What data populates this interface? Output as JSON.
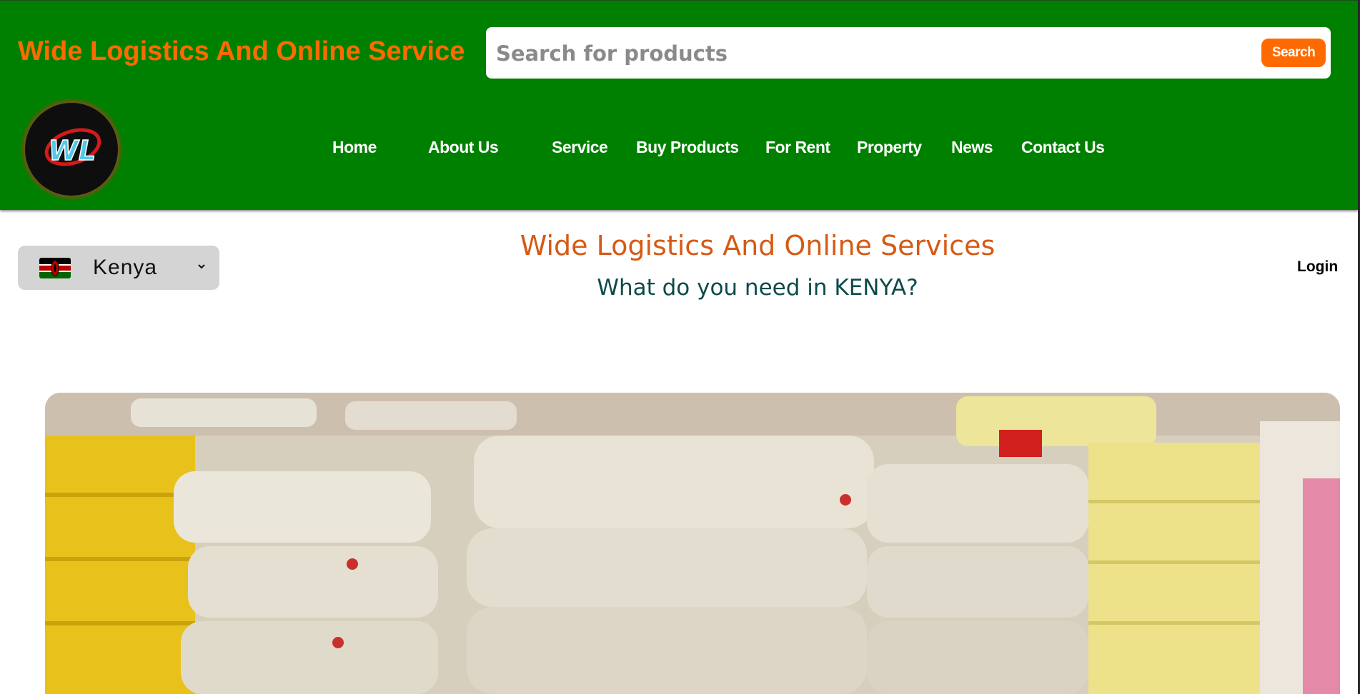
{
  "header": {
    "brand": "Wide Logistics And Online Service",
    "search": {
      "placeholder": "Search for products",
      "value": "",
      "button_label": "Search"
    },
    "logo_text": "WL",
    "nav": [
      {
        "label": "Home"
      },
      {
        "label": "About Us"
      },
      {
        "label": "Service"
      },
      {
        "label": "Buy Products"
      },
      {
        "label": "For Rent"
      },
      {
        "label": "Property"
      },
      {
        "label": "News"
      },
      {
        "label": "Contact Us"
      }
    ]
  },
  "country_selector": {
    "selected": "Kenya",
    "flag_icon": "kenya-flag-icon"
  },
  "main": {
    "title": "Wide Logistics And Online Services",
    "subtitle": "What do you need in KENYA?",
    "login_label": "Login",
    "hero_image": "rice-sacks-photo"
  },
  "colors": {
    "header_bg": "#008000",
    "accent": "#ff6a00",
    "title": "#d65a14",
    "subtitle": "#0d4a4a"
  }
}
